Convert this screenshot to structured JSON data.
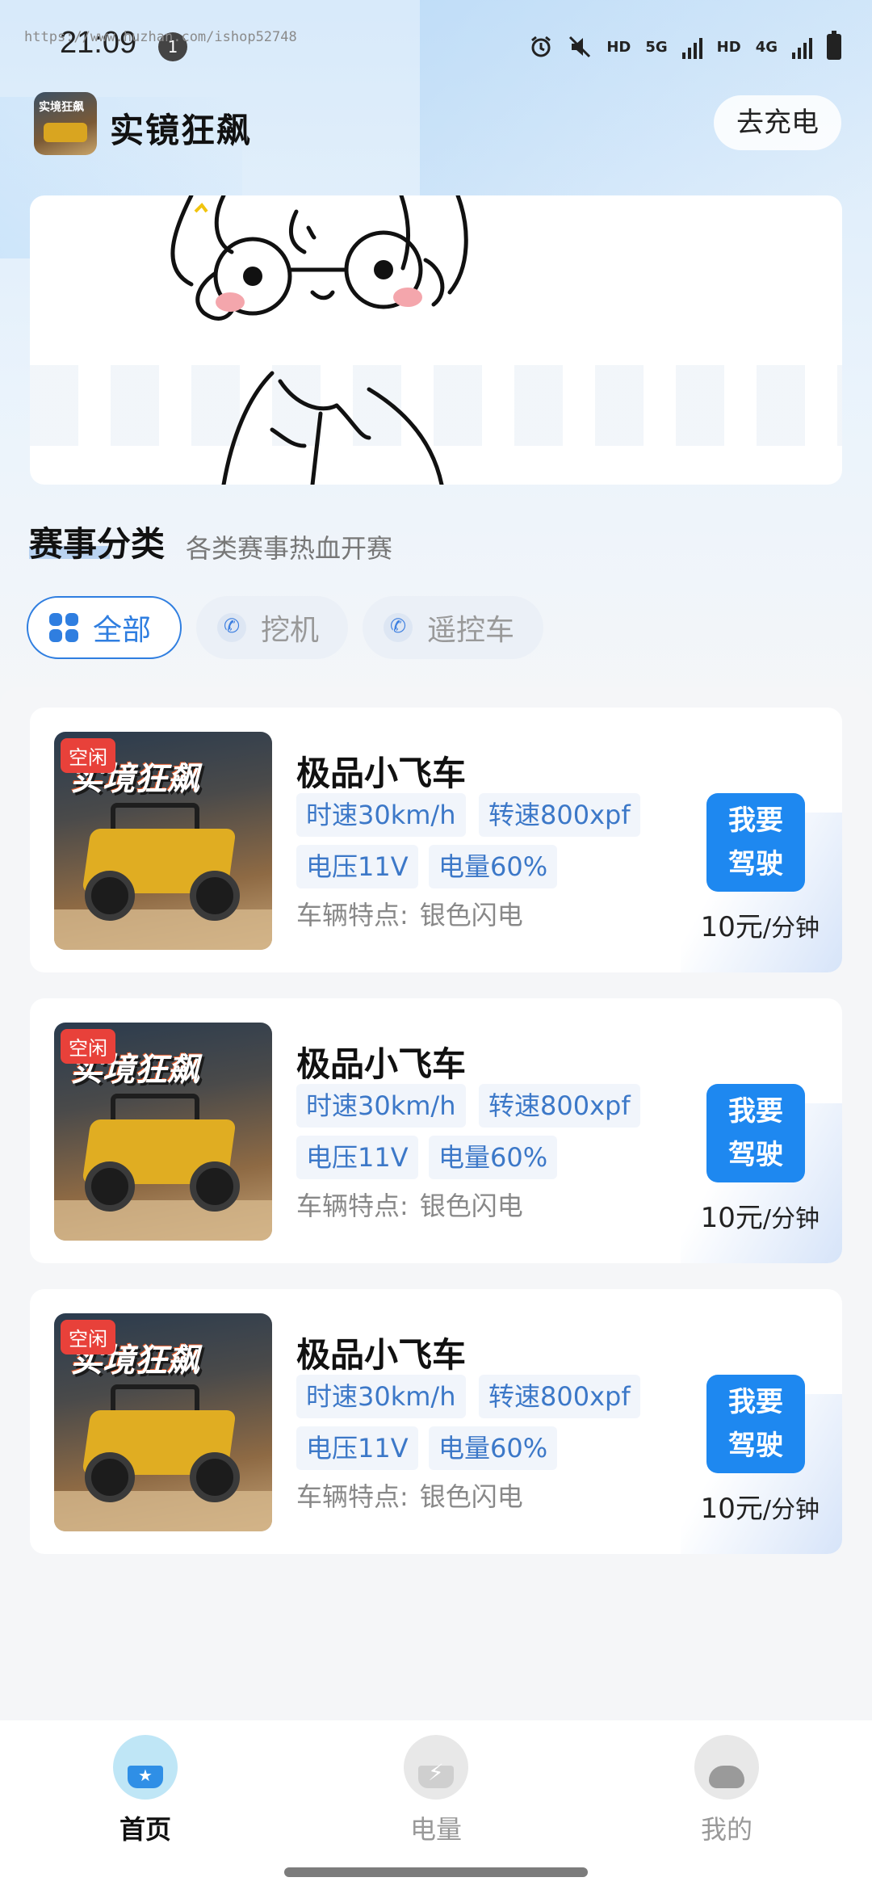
{
  "status_bar": {
    "time": "21:09",
    "notification_count": "1",
    "watermark": "https://www.huzhan.com/ishop52748",
    "icons": [
      "alarm-icon",
      "mute-icon",
      "hd-icon",
      "5g-icon",
      "signal-icon",
      "hd-icon",
      "4g-signal-icon",
      "battery-icon"
    ],
    "hd_label": "HD",
    "fiveg_label": "5G",
    "fourg_label": "4G"
  },
  "header": {
    "app_name": "实镜狂飙",
    "logo_text": "实境狂飙",
    "charge_button": "去充电"
  },
  "category": {
    "title": "赛事分类",
    "subtitle": "各类赛事热血开赛",
    "tabs": [
      {
        "label": "全部",
        "icon": "grid-icon",
        "active": true
      },
      {
        "label": "挖机",
        "icon": "phone-icon",
        "active": false
      },
      {
        "label": "遥控车",
        "icon": "phone-icon",
        "active": false
      }
    ]
  },
  "cards": [
    {
      "status": "空闲",
      "image_text": "实境狂飙",
      "name": "极品小飞车",
      "speed": "时速30km/h",
      "rpm": "转速800xpf",
      "voltage": "电压11V",
      "battery": "电量60%",
      "feature_label": "车辆特点:",
      "feature_value": "银色闪电",
      "button_line1": "我要",
      "button_line2": "驾驶",
      "price": "10元",
      "price_unit": "/分钟"
    },
    {
      "status": "空闲",
      "image_text": "实境狂飙",
      "name": "极品小飞车",
      "speed": "时速30km/h",
      "rpm": "转速800xpf",
      "voltage": "电压11V",
      "battery": "电量60%",
      "feature_label": "车辆特点:",
      "feature_value": "银色闪电",
      "button_line1": "我要",
      "button_line2": "驾驶",
      "price": "10元",
      "price_unit": "/分钟"
    },
    {
      "status": "空闲",
      "image_text": "实境狂飙",
      "name": "极品小飞车",
      "speed": "时速30km/h",
      "rpm": "转速800xpf",
      "voltage": "电压11V",
      "battery": "电量60%",
      "feature_label": "车辆特点:",
      "feature_value": "银色闪电",
      "button_line1": "我要",
      "button_line2": "驾驶",
      "price": "10元",
      "price_unit": "/分钟"
    }
  ],
  "bottom_nav": {
    "items": [
      {
        "label": "首页",
        "icon": "home-icon",
        "active": true
      },
      {
        "label": "电量",
        "icon": "battery-bolt-icon",
        "active": false
      },
      {
        "label": "我的",
        "icon": "profile-icon",
        "active": false
      }
    ]
  },
  "colors": {
    "accent": "#1e88f0",
    "tag_red": "#e8413a",
    "chip_text": "#3c78c8"
  }
}
